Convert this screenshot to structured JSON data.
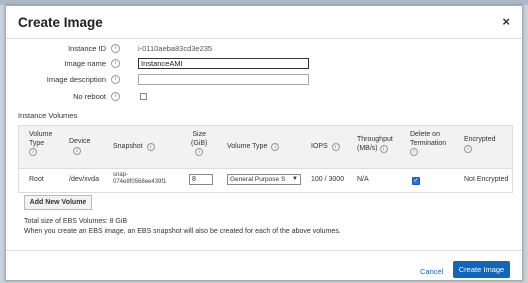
{
  "dialog": {
    "title": "Create Image",
    "close_glyph": "×"
  },
  "form": {
    "instance_id_label": "Instance ID",
    "instance_id_value": "i-0110aeba83cd3e235",
    "image_name_label": "Image name",
    "image_name_value": "InstanceAMI",
    "image_description_label": "Image description",
    "image_description_value": "",
    "no_reboot_label": "No reboot",
    "no_reboot_checked": false,
    "info_glyph": "i"
  },
  "volumes": {
    "section_title": "Instance Volumes",
    "headers": {
      "volume_type_1": "Volume",
      "volume_type_2": "Type",
      "device": "Device",
      "snapshot": "Snapshot",
      "size_1": "Size",
      "size_2": "(GiB)",
      "volume_type": "Volume Type",
      "iops": "IOPS",
      "throughput_1": "Throughput",
      "throughput_2": "(MB/s)",
      "delete_1": "Delete on",
      "delete_2": "Termination",
      "encrypted": "Encrypted"
    },
    "rows": [
      {
        "volume_type": "Root",
        "device": "/dev/xvda",
        "snapshot_1": "snap-",
        "snapshot_2": "074e8f0568ee439f1",
        "size": "8",
        "volume_type_select": "General Purpose S",
        "iops": "100 / 3000",
        "throughput": "N/A",
        "delete_on_termination": true,
        "encrypted": "Not Encrypted"
      }
    ],
    "add_button": "Add New Volume"
  },
  "notes": {
    "total_size": "Total size of EBS Volumes: 8 GiB",
    "snapshot_note": "When you create an EBS image, an EBS snapshot will also be created for each of the above volumes."
  },
  "footer": {
    "cancel": "Cancel",
    "create": "Create Image"
  },
  "colors": {
    "primary": "#1166bb",
    "checkbox_checked": "#2a6fdb"
  }
}
